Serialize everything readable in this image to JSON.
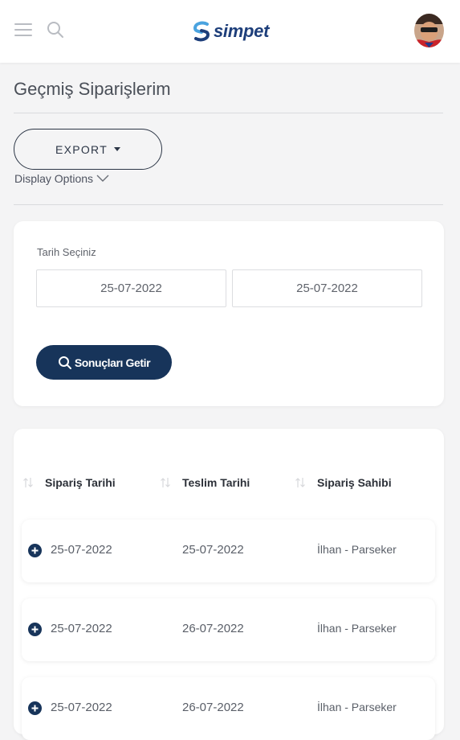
{
  "header": {
    "logo_text": "simpet",
    "icons": {
      "menu": "hamburger-menu-icon",
      "search": "search-icon",
      "avatar": "user-avatar"
    }
  },
  "page": {
    "title": "Geçmiş Siparişlerim",
    "export_label": "EXPORT",
    "display_options_label": "Display Options"
  },
  "filter": {
    "date_label": "Tarih Seçiniz",
    "start_date": "25-07-2022",
    "end_date": "25-07-2022",
    "submit_label": "Sonuçları Getir"
  },
  "table": {
    "columns": [
      "Sipariş Tarihi",
      "Teslim Tarihi",
      "Sipariş Sahibi"
    ],
    "rows": [
      {
        "order_date": "25-07-2022",
        "delivery_date": "25-07-2022",
        "owner": "İlhan - Parseker"
      },
      {
        "order_date": "25-07-2022",
        "delivery_date": "26-07-2022",
        "owner": "İlhan - Parseker"
      },
      {
        "order_date": "25-07-2022",
        "delivery_date": "26-07-2022",
        "owner": "İlhan - Parseker"
      }
    ]
  },
  "colors": {
    "primary_button": "#17345a",
    "logo_blue": "#1d3e7a",
    "logo_light_blue": "#4aa3df",
    "background": "#f4f4f5"
  }
}
